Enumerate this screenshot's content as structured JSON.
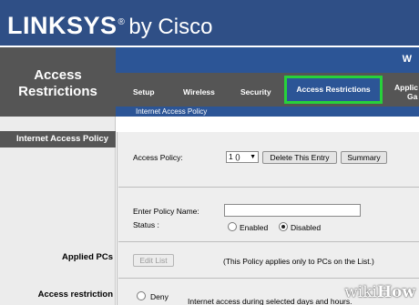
{
  "brand": {
    "name": "LINKSYS",
    "reg": "®",
    "by": "by Cisco"
  },
  "section": {
    "title_line1": "Access",
    "title_line2": "Restrictions",
    "header_right": "W"
  },
  "tabs": [
    {
      "label": "Setup"
    },
    {
      "label": "Wireless"
    },
    {
      "label": "Security"
    },
    {
      "label": "Access Restrictions",
      "active": true
    },
    {
      "label_line1": "Applic",
      "label_line2": "Ga"
    }
  ],
  "subnav": {
    "items": [
      "Internet Access Policy"
    ]
  },
  "sidebar": {
    "header": "Internet Access Policy",
    "applied_pcs": "Applied PCs",
    "access_restriction": "Access restriction"
  },
  "form": {
    "access_policy_label": "Access Policy:",
    "policy_select_value": "1 ()",
    "delete_button": "Delete This Entry",
    "summary_button": "Summary",
    "policy_name_label": "Enter Policy Name:",
    "policy_name_value": "",
    "status_label": "Status :",
    "status_enabled": "Enabled",
    "status_disabled": "Disabled",
    "status_selected": "Disabled",
    "edit_list_button": "Edit List",
    "applies_note": "(This Policy applies only to PCs on the List.)",
    "deny_label": "Deny",
    "internet_access_note": "Internet access during selected days and hours."
  },
  "watermark": {
    "prefix": "wiki",
    "suffix": "How"
  },
  "colors": {
    "brand_blue": "#2f4f86",
    "nav_blue": "#2c5596",
    "nav_gray": "#555555",
    "highlight_green": "#27d13a"
  }
}
